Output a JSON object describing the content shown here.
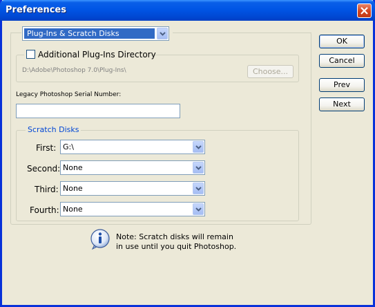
{
  "window": {
    "title": "Preferences"
  },
  "section_select": {
    "value": "Plug-Ins & Scratch Disks"
  },
  "plugins": {
    "checkbox_label": "Additional Plug-Ins Directory",
    "checked": false,
    "path": "D:\\Adobe\\Photoshop 7.0\\Plug-Ins\\",
    "choose_label": "Choose..."
  },
  "serial": {
    "label": "Legacy Photoshop Serial Number:",
    "value": ""
  },
  "scratch": {
    "legend": "Scratch Disks",
    "first": {
      "label": "First:",
      "value": "G:\\"
    },
    "second": {
      "label": "Second:",
      "value": "None"
    },
    "third": {
      "label": "Third:",
      "value": "None"
    },
    "fourth": {
      "label": "Fourth:",
      "value": "None"
    }
  },
  "note": {
    "line1": "Note: Scratch disks will remain",
    "line2": "in use until you quit Photoshop.",
    "icon": "info-icon"
  },
  "buttons": {
    "ok": "OK",
    "cancel": "Cancel",
    "prev": "Prev",
    "next": "Next"
  },
  "colors": {
    "titlebar": "#0055e5",
    "dialog_bg": "#ece9d8",
    "legend_text": "#0046d5"
  }
}
